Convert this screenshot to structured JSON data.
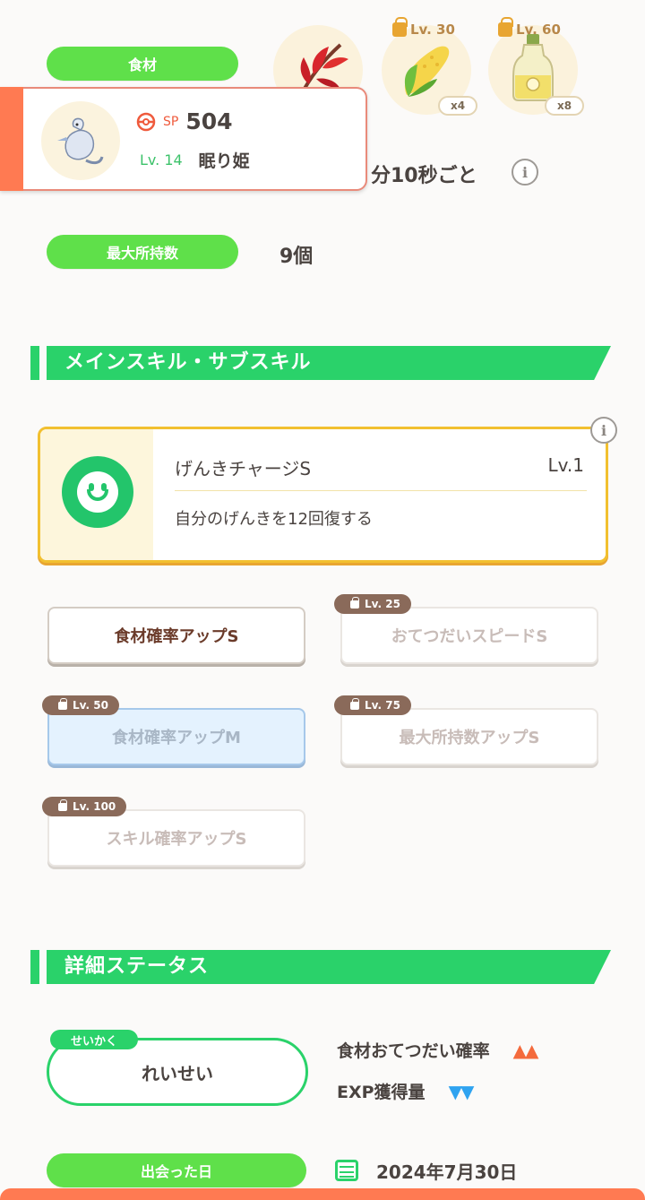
{
  "ingredients": {
    "label": "食材",
    "items": [
      {
        "name": "red-leaf",
        "icon": "red-herb-icon",
        "lock_label": "",
        "qty": ""
      },
      {
        "name": "corn",
        "icon": "corn-icon",
        "lock_label": "Lv. 30",
        "qty": "x4"
      },
      {
        "name": "oil",
        "icon": "oil-bottle-icon",
        "lock_label": "Lv. 60",
        "qty": "x8"
      }
    ]
  },
  "pokemon_card": {
    "sp_label": "SP",
    "sp_value": "504",
    "level": "Lv. 14",
    "name": "眠り姫"
  },
  "help_interval": "分10秒ごと",
  "max_carry": {
    "label": "最大所持数",
    "value": "9個"
  },
  "skills_section": {
    "title": "メインスキル・サブスキル",
    "main_skill": {
      "name": "げんきチャージS",
      "level": "Lv.1",
      "description": "自分のげんきを12回復する"
    },
    "sub_skills": [
      {
        "label": "食材確率アップS",
        "lock": "",
        "state": "active"
      },
      {
        "label": "おてつだいスピードS",
        "lock": "Lv. 25",
        "state": "locked"
      },
      {
        "label": "食材確率アップM",
        "lock": "Lv. 50",
        "state": "locked-blue"
      },
      {
        "label": "最大所持数アップS",
        "lock": "Lv. 75",
        "state": "locked"
      },
      {
        "label": "スキル確率アップS",
        "lock": "Lv. 100",
        "state": "locked"
      }
    ]
  },
  "details_section": {
    "title": "詳細ステータス",
    "nature_tag": "せいかく",
    "nature": "れいせい",
    "effects": [
      {
        "label": "食材おてつだい確率",
        "arrows": "▲▲",
        "direction": "up"
      },
      {
        "label": "EXP獲得量",
        "arrows": "▼▼",
        "direction": "down"
      }
    ],
    "met_date_label": "出会った日",
    "met_date": "2024年7月30日"
  },
  "colors": {
    "green": "#2ad26a",
    "pill_green": "#5fe04a",
    "accent_orange": "#ff7a52",
    "gold": "#f2c030"
  }
}
